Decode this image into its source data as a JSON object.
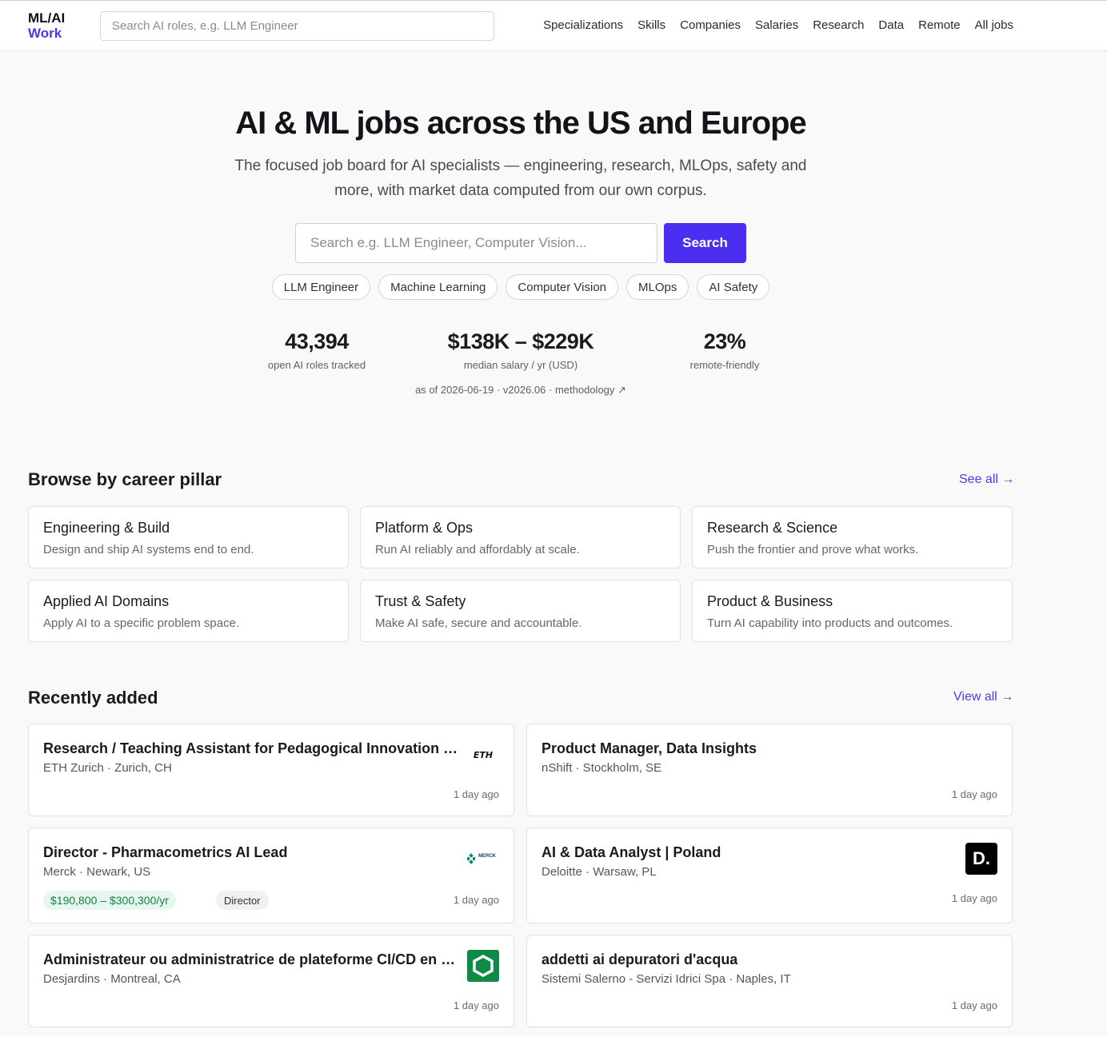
{
  "brand": {
    "line1": "ML/AI",
    "line2": "Work"
  },
  "header": {
    "search_placeholder": "Search AI roles, e.g. LLM Engineer",
    "nav": [
      "Specializations",
      "Skills",
      "Companies",
      "Salaries",
      "Research",
      "Data",
      "Remote",
      "All jobs"
    ]
  },
  "hero": {
    "title": "AI & ML jobs across the US and Europe",
    "subtitle": "The focused job board for AI specialists — engineering, research, MLOps, safety and more, with market data computed from our own corpus.",
    "search_placeholder": "Search e.g. LLM Engineer, Computer Vision...",
    "search_button": "Search",
    "chips": [
      "LLM Engineer",
      "Machine Learning",
      "Computer Vision",
      "MLOps",
      "AI Safety"
    ],
    "stats": [
      {
        "value": "43,394",
        "label": "open AI roles tracked"
      },
      {
        "value": "$138K – $229K",
        "label": "median salary / yr (USD)"
      },
      {
        "value": "23%",
        "label": "remote-friendly"
      }
    ],
    "as_of": "as of 2026-06-19 · v2026.06 · methodology ↗"
  },
  "pillars": {
    "title": "Browse by career pillar",
    "link": "See all →",
    "items": [
      {
        "title": "Engineering & Build",
        "desc": "Design and ship AI systems end to end."
      },
      {
        "title": "Platform & Ops",
        "desc": "Run AI reliably and affordably at scale."
      },
      {
        "title": "Research & Science",
        "desc": "Push the frontier and prove what works."
      },
      {
        "title": "Applied AI Domains",
        "desc": "Apply AI to a specific problem space."
      },
      {
        "title": "Trust & Safety",
        "desc": "Make AI safe, secure and accountable."
      },
      {
        "title": "Product & Business",
        "desc": "Turn AI capability into products and outcomes."
      }
    ]
  },
  "recent": {
    "title": "Recently added",
    "link": "View all →",
    "jobs": [
      {
        "title": "Research / Teaching Assistant for Pedagogical Innovation a...",
        "meta": "ETH Zurich · Zurich, CH",
        "ago": "1 day ago",
        "logo_text": "ETH"
      },
      {
        "title": "Product Manager, Data Insights",
        "meta": "nShift · Stockholm, SE",
        "ago": "1 day ago"
      },
      {
        "title": "Director - Pharmacometrics AI Lead",
        "meta": "Merck · Newark, US",
        "ago": "1 day ago",
        "salary": "$190,800 – $300,300/yr",
        "level": "Director",
        "logo_text": "MERCK"
      },
      {
        "title": "AI & Data Analyst | Poland",
        "meta": "Deloitte · Warsaw, PL",
        "ago": "1 day ago",
        "logo_text": "D."
      },
      {
        "title": "Administrateur ou administratrice de plateforme CI/CD en IA...",
        "meta": "Desjardins · Montreal, CA",
        "ago": "1 day ago"
      },
      {
        "title": "addetti ai depuratori d'acqua",
        "meta": "Sistemi Salerno - Servizi Idrici Spa · Naples, IT",
        "ago": "1 day ago"
      }
    ]
  },
  "colors": {
    "accent": "#4a2ff0",
    "salary_bg": "#e7f6ee",
    "salary_fg": "#17804a",
    "desjardins": "#0f8a46"
  }
}
